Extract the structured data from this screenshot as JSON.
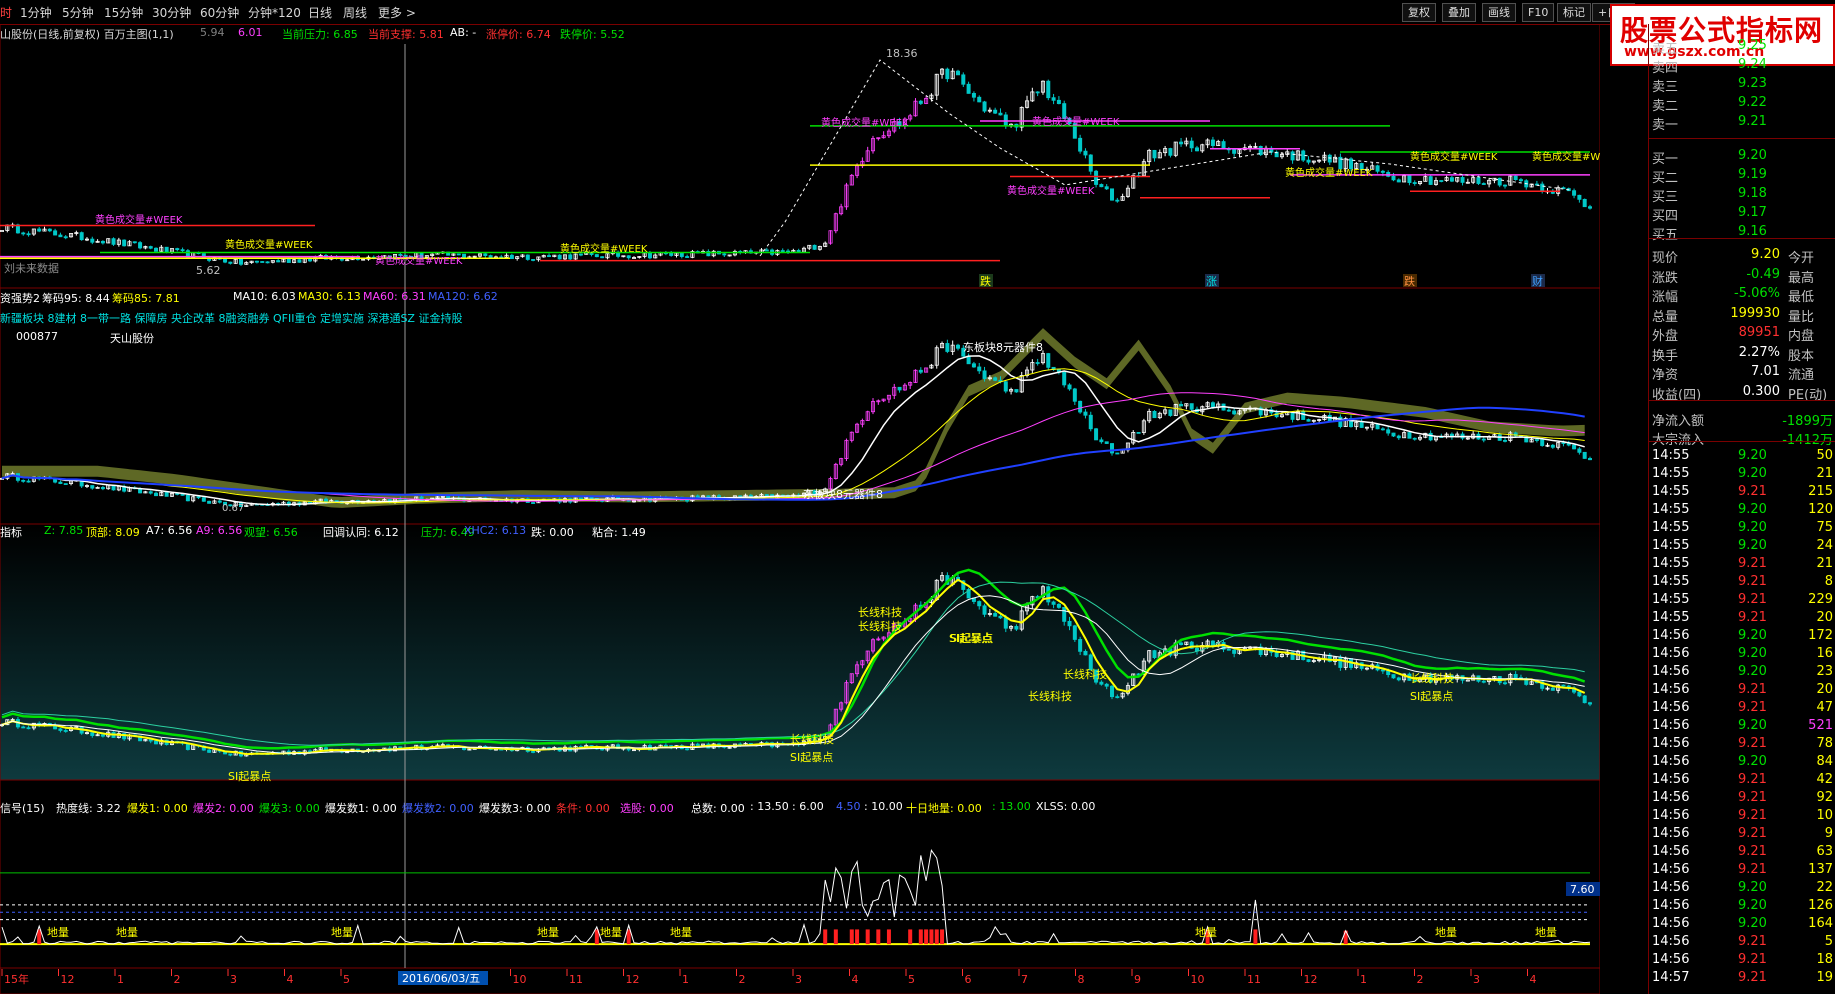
{
  "toolbar": {
    "periods": [
      "时",
      "1分钟",
      "5分钟",
      "15分钟",
      "30分钟",
      "60分钟",
      "分钟*120",
      "日线",
      "周线",
      "更多 >"
    ],
    "buttons": [
      "复权",
      "叠加",
      "画线",
      "F10",
      "标记",
      "+自选"
    ]
  },
  "watermark": {
    "line1": "股票公式指标网",
    "line2": "www.gszx.com.cn"
  },
  "panel1": {
    "title": "山股份(日线,前复权) 百万主图(1,1)",
    "v1": "5.94",
    "v2": "6.01",
    "pressure": "当前压力: 6.85",
    "support": "当前支撑: 5.81",
    "ab": "AB: -",
    "limit_up": "涨停价: 6.74",
    "limit_down": "跌停价: 5.52",
    "high_label": "18.36",
    "low_label": "5.62",
    "future_label": "刘未来数据",
    "week_label": "黄色成交量#WEEK",
    "markers": [
      "跌",
      "涨",
      "跌",
      "财"
    ],
    "axis": [
      "16.00",
      "14.00",
      "12.00",
      "10.00",
      "8.00",
      "6.00"
    ]
  },
  "panel2": {
    "header": "资强势2",
    "chip95": "筹码95: 8.44",
    "chip85": "筹码85: 7.81",
    "ma10": "MA10: 6.03",
    "ma30": "MA30: 6.13",
    "ma60": "MA60: 6.31",
    "ma120": "MA120: 6.62",
    "concepts": "新疆板块 8建材 8一带一路 保障房 央企改革 8融资融券 QFII重仓 定增实施 深港通SZ 证金持股",
    "code": "000877",
    "name": "天山股份",
    "label_a": "东板块8元器件8",
    "label_b": "东板块8元器件8",
    "low_label": "0.67",
    "axis": [
      "18.00",
      "16.00",
      "14.00",
      "12.00",
      "10.00",
      "8.00",
      "6.00"
    ]
  },
  "panel3": {
    "header": "指标",
    "z": "Z: 7.85",
    "top": "顶部: 8.09",
    "a7": "A7: 6.56",
    "a9": "A9: 6.56",
    "watch": "观望: 6.56",
    "pullback": "回调认同: 6.12",
    "pressure": "压力: 6.49",
    "xhc2": "XHC2: 6.13",
    "fall": "跌: 0.00",
    "stick": "粘合: 1.49",
    "labels": [
      "长线科技",
      "SI起暴点",
      "长线科技",
      "SI起暴点",
      "长线科技",
      "长线科技",
      "长线科技",
      "SI起暴点",
      "长线科技",
      "SI起暴点",
      "SI起暴点"
    ],
    "axis": [
      "18.00",
      "16.00",
      "14.00",
      "12.00",
      "10.00",
      "8.00",
      "6.00"
    ]
  },
  "panel4": {
    "header": "信号(15)",
    "heat": "热度线: 3.22",
    "b1": "爆发1: 0.00",
    "b2": "爆发2: 0.00",
    "b3": "爆发3: 0.00",
    "bn1": "爆发数1: 0.00",
    "bn2": "爆发数2: 0.00",
    "bn3": "爆发数3: 0.00",
    "cond": "条件: 0.00",
    "pick": "选股: 0.00",
    "total": "总数: 0.00",
    "t1": ": 13.50",
    "t2": ": 6.00",
    "t3": "4.50",
    "t4": ": 10.00",
    "ten": "十日地量: 0.00",
    "t5": ": 13.00",
    "xlss": "XLSS: 0.00",
    "tag": "7.60",
    "vol_label": "地量",
    "axis": [
      "20.00",
      "15.00",
      "10.00",
      "5.00",
      "0.00"
    ]
  },
  "dates": {
    "current": "2016/06/03/五",
    "months": [
      "15年",
      "12",
      "1",
      "2",
      "3",
      "4",
      "5",
      "8",
      "9",
      "10",
      "11",
      "12",
      "1",
      "2",
      "3",
      "4",
      "5",
      "6",
      "7",
      "8",
      "9",
      "10",
      "11",
      "12",
      "1",
      "2",
      "3",
      "4"
    ],
    "right": "日线"
  },
  "quote": {
    "asks": [
      {
        "l": "卖五",
        "v": "9.25"
      },
      {
        "l": "卖四",
        "v": "9.24"
      },
      {
        "l": "卖三",
        "v": "9.23"
      },
      {
        "l": "卖二",
        "v": "9.22"
      },
      {
        "l": "卖一",
        "v": "9.21"
      }
    ],
    "bids": [
      {
        "l": "买一",
        "v": "9.20"
      },
      {
        "l": "买二",
        "v": "9.19"
      },
      {
        "l": "买三",
        "v": "9.18"
      },
      {
        "l": "买四",
        "v": "9.17"
      },
      {
        "l": "买五",
        "v": "9.16"
      }
    ],
    "stats": [
      {
        "l": "现价",
        "v": "9.20",
        "r": "今开",
        "c": "#ffff00"
      },
      {
        "l": "涨跌",
        "v": "-0.49",
        "r": "最高",
        "c": "#00e000"
      },
      {
        "l": "涨幅",
        "v": "-5.06%",
        "r": "最低",
        "c": "#00e000"
      },
      {
        "l": "总量",
        "v": "199930",
        "r": "量比",
        "c": "#ffff00"
      },
      {
        "l": "外盘",
        "v": "89951",
        "r": "内盘",
        "c": "#ff3030"
      },
      {
        "l": "换手",
        "v": "2.27%",
        "r": "股本",
        "c": "#ffffff"
      },
      {
        "l": "净资",
        "v": "7.01",
        "r": "流通",
        "c": "#ffffff"
      },
      {
        "l": "收益(四)",
        "v": "0.300",
        "r": "PE(动)",
        "c": "#ffffff"
      }
    ],
    "netflow_label": "净流入额",
    "netflow_value": "-1899万",
    "block_label": "大宗流入",
    "block_value": "-1412万",
    "ticks": [
      [
        "14:55",
        "9.20",
        "50"
      ],
      [
        "14:55",
        "9.20",
        "21"
      ],
      [
        "14:55",
        "9.21",
        "215"
      ],
      [
        "14:55",
        "9.20",
        "120"
      ],
      [
        "14:55",
        "9.20",
        "75"
      ],
      [
        "14:55",
        "9.20",
        "24"
      ],
      [
        "14:55",
        "9.21",
        "21"
      ],
      [
        "14:55",
        "9.21",
        "8"
      ],
      [
        "14:55",
        "9.21",
        "229"
      ],
      [
        "14:55",
        "9.21",
        "20"
      ],
      [
        "14:56",
        "9.20",
        "172"
      ],
      [
        "14:56",
        "9.20",
        "16"
      ],
      [
        "14:56",
        "9.20",
        "23"
      ],
      [
        "14:56",
        "9.21",
        "20"
      ],
      [
        "14:56",
        "9.21",
        "47"
      ],
      [
        "14:56",
        "9.20",
        "521"
      ],
      [
        "14:56",
        "9.21",
        "78"
      ],
      [
        "14:56",
        "9.20",
        "84"
      ],
      [
        "14:56",
        "9.21",
        "42"
      ],
      [
        "14:56",
        "9.21",
        "92"
      ],
      [
        "14:56",
        "9.21",
        "10"
      ],
      [
        "14:56",
        "9.21",
        "9"
      ],
      [
        "14:56",
        "9.21",
        "63"
      ],
      [
        "14:56",
        "9.21",
        "137"
      ],
      [
        "14:56",
        "9.20",
        "22"
      ],
      [
        "14:56",
        "9.20",
        "126"
      ],
      [
        "14:56",
        "9.20",
        "164"
      ],
      [
        "14:56",
        "9.21",
        "5"
      ],
      [
        "14:56",
        "9.21",
        "18"
      ],
      [
        "14:57",
        "9.21",
        "19"
      ]
    ],
    "tick_vol_colors": [
      "#ffff00",
      "#ffff00",
      "#ffff00",
      "#ffff00",
      "#ffff00",
      "#ffff00",
      "#ffff00",
      "#ffff00",
      "#ffff00",
      "#ffff00",
      "#ffff00",
      "#ffff00",
      "#ffff00",
      "#ffff00",
      "#ffff00",
      "#ff40ff",
      "#ffff00",
      "#ffff00",
      "#ffff00",
      "#ffff00",
      "#ffff00",
      "#ffff00",
      "#ffff00",
      "#ffff00",
      "#ffff00",
      "#ffff00",
      "#ffff00",
      "#ffff00",
      "#ffff00",
      "#ffff00"
    ]
  }
}
